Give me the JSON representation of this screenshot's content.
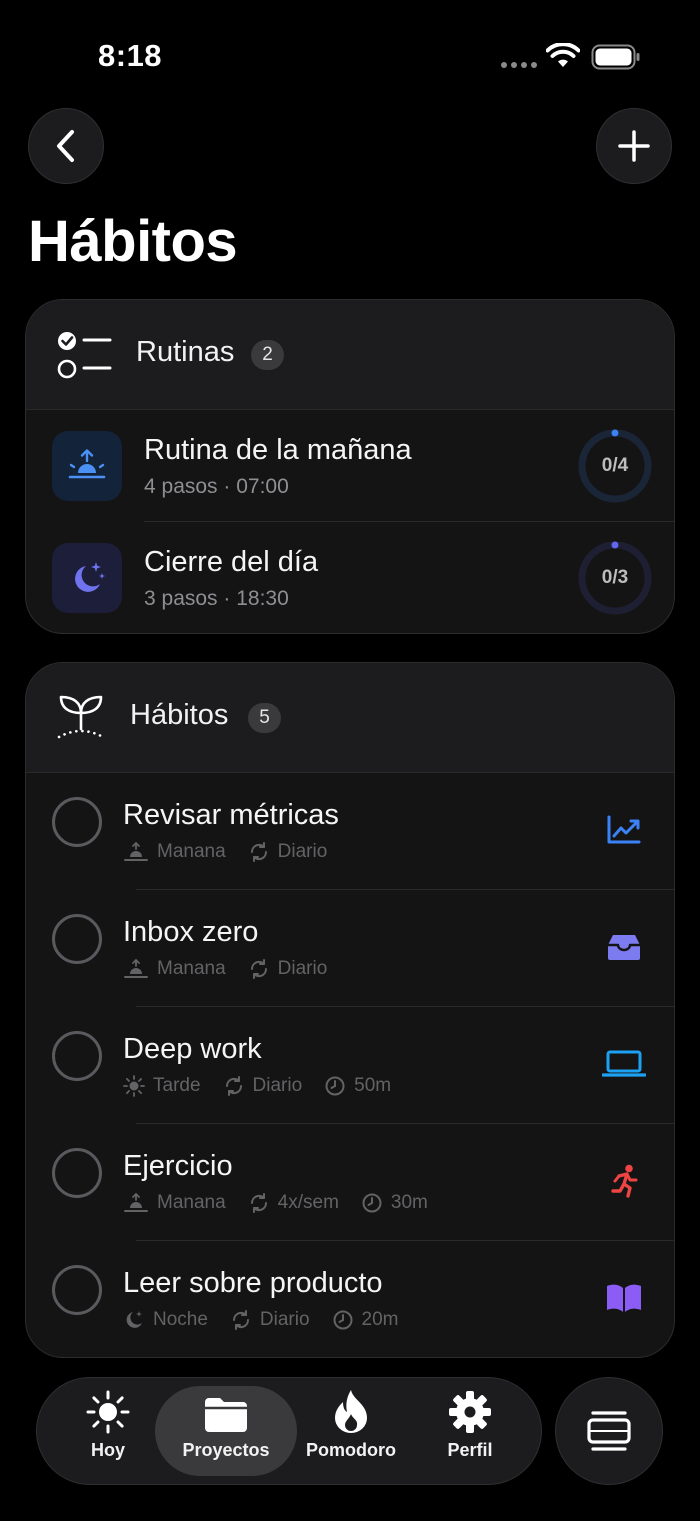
{
  "status_bar": {
    "time": "8:18"
  },
  "page": {
    "title": "Hábitos"
  },
  "routines": {
    "header_label": "Rutinas",
    "count": "2",
    "items": [
      {
        "title": "Rutina de la mañana",
        "subtitle": "4 pasos · 07:00",
        "progress_label": "0/4",
        "progress": 0,
        "icon": "sunrise-icon",
        "accent": "#3b82f6"
      },
      {
        "title": "Cierre del día",
        "subtitle": "3 pasos · 18:30",
        "progress_label": "0/3",
        "progress": 0,
        "icon": "moon-stars-icon",
        "accent": "#6366f1"
      }
    ]
  },
  "habits": {
    "header_label": "Hábitos",
    "count": "5",
    "items": [
      {
        "title": "Revisar métricas",
        "time_of_day": "Manana",
        "frequency": "Diario",
        "duration": "",
        "icon": "chart-line-icon",
        "icon_color": "#3b82f6"
      },
      {
        "title": "Inbox zero",
        "time_of_day": "Manana",
        "frequency": "Diario",
        "duration": "",
        "icon": "inbox-tray-icon",
        "icon_color": "#7c7cf0"
      },
      {
        "title": "Deep work",
        "time_of_day": "Tarde",
        "frequency": "Diario",
        "duration": "50m",
        "icon": "laptop-icon",
        "icon_color": "#1da1f2"
      },
      {
        "title": "Ejercicio",
        "time_of_day": "Manana",
        "frequency": "4x/sem",
        "duration": "30m",
        "icon": "running-icon",
        "icon_color": "#ef4444"
      },
      {
        "title": "Leer sobre producto",
        "time_of_day": "Noche",
        "frequency": "Diario",
        "duration": "20m",
        "icon": "book-open-icon",
        "icon_color": "#8b5cf6"
      }
    ]
  },
  "tab_bar": {
    "tabs": [
      {
        "label": "Hoy",
        "icon": "sun-icon"
      },
      {
        "label": "Proyectos",
        "icon": "folder-icon",
        "active": true
      },
      {
        "label": "Pomodoro",
        "icon": "flame-icon"
      },
      {
        "label": "Perfil",
        "icon": "gear-icon"
      }
    ]
  }
}
